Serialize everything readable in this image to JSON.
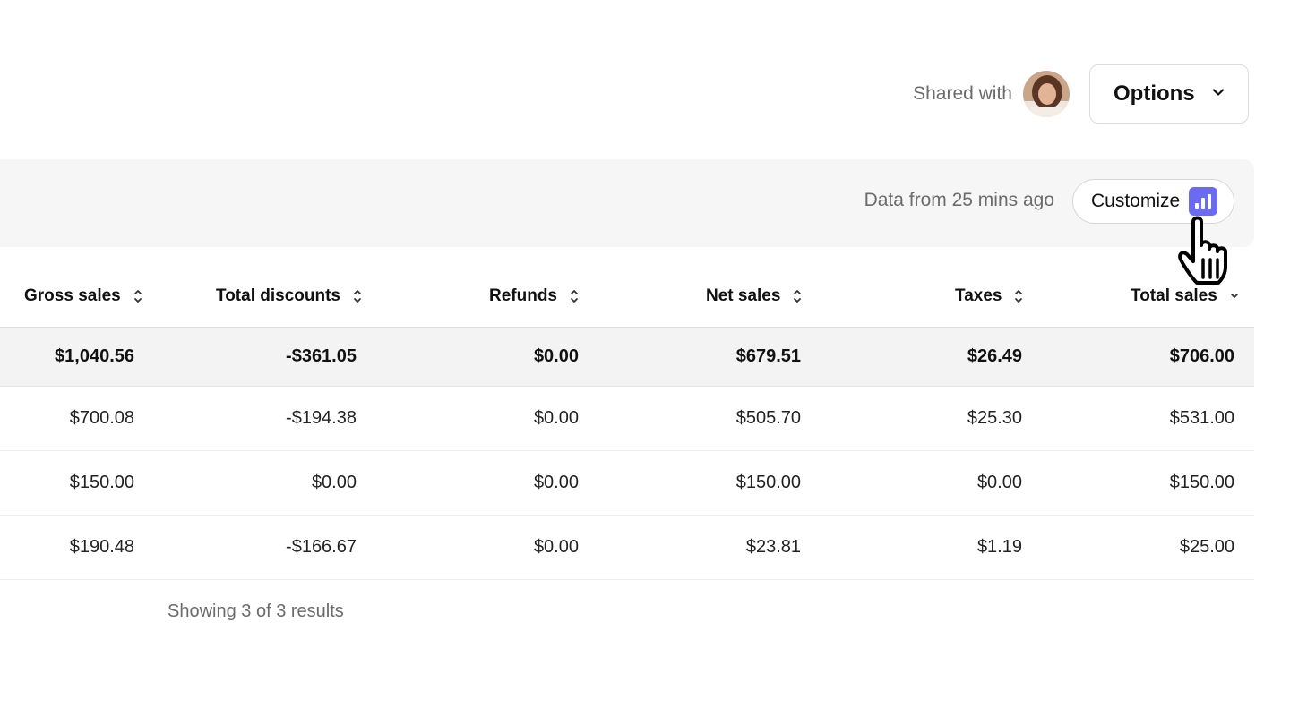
{
  "header": {
    "shared_with_label": "Shared with",
    "options_label": "Options"
  },
  "band": {
    "data_from": "Data from 25 mins ago",
    "customize_label": "Customize"
  },
  "table": {
    "columns": [
      "Gross sales",
      "Total discounts",
      "Refunds",
      "Net sales",
      "Taxes",
      "Total sales"
    ],
    "total_row": [
      "$1,040.56",
      "-$361.05",
      "$0.00",
      "$679.51",
      "$26.49",
      "$706.00"
    ],
    "rows": [
      [
        "$700.08",
        "-$194.38",
        "$0.00",
        "$505.70",
        "$25.30",
        "$531.00"
      ],
      [
        "$150.00",
        "$0.00",
        "$0.00",
        "$150.00",
        "$0.00",
        "$150.00"
      ],
      [
        "$190.48",
        "-$166.67",
        "$0.00",
        "$23.81",
        "$1.19",
        "$25.00"
      ]
    ]
  },
  "footer": {
    "showing": "Showing 3 of 3 results"
  },
  "colors": {
    "accent": "#6a6bf0"
  },
  "icons": {
    "options": "chevron-down-icon",
    "customize": "bar-chart-icon",
    "sort": "sort-arrows-icon",
    "cursor": "hand-pointer-icon"
  }
}
